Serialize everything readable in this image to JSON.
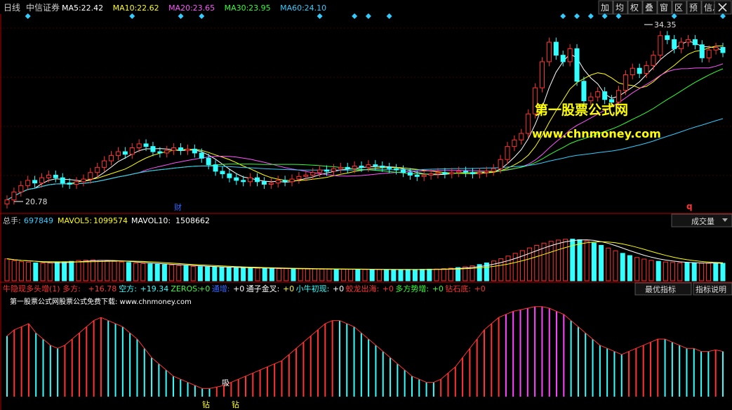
{
  "header": {
    "period": "日线",
    "stock": "中信证券",
    "ma": [
      {
        "label": "MA5:",
        "value": "22.42",
        "color": "#ffffff"
      },
      {
        "label": "MA10:",
        "value": "22.62",
        "color": "#ffff00"
      },
      {
        "label": "MA20:",
        "value": "23.65",
        "color": "#ff55ff"
      },
      {
        "label": "MA30:",
        "value": "23.95",
        "color": "#33ff33"
      },
      {
        "label": "MA60:",
        "value": "24.10",
        "color": "#33ccff"
      }
    ]
  },
  "toolbar": [
    {
      "label": "加",
      "icon": "plus-icon"
    },
    {
      "label": "均",
      "icon": "average-icon"
    },
    {
      "label": "权",
      "icon": "rights-icon"
    },
    {
      "label": "叠",
      "icon": "overlay-icon"
    },
    {
      "label": "窗",
      "icon": "window-icon"
    },
    {
      "label": "区",
      "icon": "range-icon"
    },
    {
      "label": "预",
      "icon": "forecast-icon"
    },
    {
      "label": "信息",
      "icon": "info-icon"
    }
  ],
  "close_icon": "close-icon",
  "price_panel": {
    "high_label": "34.35",
    "low_label": "20.78",
    "finance_marker": "财",
    "q_marker": "q",
    "watermark_title": "第一股票公式网",
    "watermark_url": "www.chnmoney.com"
  },
  "volume_panel": {
    "total_label": "总手:",
    "total_value": "697849",
    "mavol5_label": "MAVOL5:",
    "mavol5_value": "1099574",
    "mavol10_label": "MAVOL10:",
    "mavol10_value": "1508662",
    "dropdown_label": "成交量"
  },
  "indicator_panel": {
    "items": [
      {
        "label": "牛隐现多头增(1) 多方:",
        "value": "+16.78",
        "label_color": "#ff3333",
        "value_color": "#ff3333"
      },
      {
        "label": "空方:",
        "value": "+19.34",
        "label_color": "#33ffff",
        "value_color": "#33ffff"
      },
      {
        "label": "ZEROS:",
        "value": "+0",
        "label_color": "#33ff33",
        "value_color": "#33ff33"
      },
      {
        "label": "通增:",
        "value": "+0",
        "label_color": "#3366ff",
        "value_color": "#ffffff"
      },
      {
        "label": "通子金叉:",
        "value": "+0",
        "label_color": "#ffffff",
        "value_color": "#ffff00"
      },
      {
        "label": "小牛初现:",
        "value": "+0",
        "label_color": "#33ffff",
        "value_color": "#ffffff"
      },
      {
        "label": "蛟龙出海:",
        "value": "+0",
        "label_color": "#ff3333",
        "value_color": "#ff3333"
      },
      {
        "label": "多方势增:",
        "value": "+0",
        "label_color": "#33ff33",
        "value_color": "#33ff33"
      },
      {
        "label": "钻石底:",
        "value": "+0",
        "label_color": "#ff3333",
        "value_color": "#ff3333"
      }
    ],
    "optimal_button": "最优指标",
    "help_button": "指标说明",
    "subtitle": "第一股票公式网股票公式免费下载: www.chnmoney.com",
    "marks": {
      "buy": "吸",
      "diamond": "钻"
    }
  },
  "colors": {
    "up": "#ff3333",
    "down": "#33ffff",
    "signal": "#33ccff",
    "pink": "#ff44ff",
    "axis": "#b00000"
  },
  "chart_data": [
    {
      "type": "candlestick",
      "note_high": 34.35,
      "note_low": 20.78,
      "close": [
        20.9,
        21.5,
        22.0,
        22.4,
        22.2,
        22.6,
        22.8,
        22.6,
        22.2,
        22.1,
        22.3,
        22.5,
        23.0,
        23.4,
        23.9,
        24.3,
        24.6,
        24.4,
        24.9,
        25.2,
        25.0,
        24.6,
        24.5,
        24.7,
        24.9,
        24.7,
        24.8,
        24.5,
        24.1,
        23.6,
        23.1,
        22.9,
        22.6,
        22.4,
        22.3,
        22.6,
        22.3,
        22.1,
        22.2,
        22.4,
        22.3,
        22.5,
        22.7,
        22.8,
        23.0,
        23.2,
        23.1,
        23.3,
        23.4,
        23.3,
        23.5,
        23.4,
        23.6,
        23.5,
        23.4,
        23.3,
        23.2,
        23.0,
        22.8,
        22.7,
        22.8,
        22.9,
        23.0,
        22.9,
        23.0,
        23.1,
        23.0,
        22.9,
        23.0,
        23.1,
        23.3,
        24.0,
        25.0,
        25.5,
        26.0,
        27.5,
        29.5,
        31.5,
        33.0,
        32.0,
        31.5,
        32.5,
        30.0,
        28.5,
        28.8,
        29.2,
        28.6,
        28.4,
        29.3,
        30.5,
        31.0,
        30.6,
        31.2,
        32.0,
        33.5,
        33.2,
        32.5,
        33.0,
        33.2,
        32.8,
        31.8,
        32.4,
        32.6,
        32.2
      ]
    },
    {
      "type": "bar",
      "series": [
        {
          "name": "总手",
          "values": [
            1380,
            1260,
            1200,
            1170,
            1120,
            1100,
            1120,
            1160,
            1190,
            1220,
            1270,
            1290,
            1310,
            1280,
            1250,
            1220,
            1180,
            1150,
            1100,
            1080,
            1060,
            1040,
            1010,
            990,
            960,
            940,
            910,
            890,
            870,
            860,
            840,
            830,
            820,
            810,
            800,
            790,
            780,
            770,
            760,
            760,
            750,
            750,
            740,
            740,
            730,
            730,
            730,
            720,
            720,
            720,
            710,
            710,
            710,
            700,
            700,
            700,
            710,
            710,
            720,
            730,
            740,
            760,
            790,
            830,
            880,
            940,
            1020,
            1120,
            1240,
            1380,
            1550,
            1720,
            1890,
            2060,
            2220,
            2360,
            2470,
            2550,
            2600,
            2610,
            2570,
            2490,
            2370,
            2220,
            2050,
            1880,
            1720,
            1580,
            1460,
            1360,
            1280,
            1220,
            1180,
            1150,
            1130,
            1120,
            1110,
            1100,
            1100,
            1100,
            1098
          ]
        }
      ]
    },
    {
      "type": "bar",
      "series": [
        {
          "name": "牛隐现多头增",
          "values": [
            12,
            16,
            18,
            20,
            14,
            10,
            6,
            4,
            6,
            10,
            14,
            18,
            22,
            24,
            22,
            20,
            18,
            14,
            10,
            4,
            -2,
            -6,
            -10,
            -14,
            -16,
            -18,
            -20,
            -22,
            -22,
            -21,
            -20,
            -18,
            -16,
            -14,
            -12,
            -10,
            -8,
            -6,
            -4,
            0,
            4,
            8,
            12,
            16,
            20,
            22,
            22,
            20,
            18,
            14,
            10,
            6,
            2,
            -2,
            -6,
            -10,
            -14,
            -16,
            -18,
            -18,
            -16,
            -12,
            -8,
            -2,
            4,
            10,
            16,
            20,
            24,
            26,
            28,
            29,
            30,
            31,
            31,
            30,
            28,
            26,
            22,
            18,
            14,
            10,
            6,
            4,
            2,
            0,
            2,
            4,
            6,
            8,
            10,
            10,
            8,
            6,
            4,
            4,
            2,
            2,
            3,
            2
          ]
        }
      ]
    }
  ]
}
